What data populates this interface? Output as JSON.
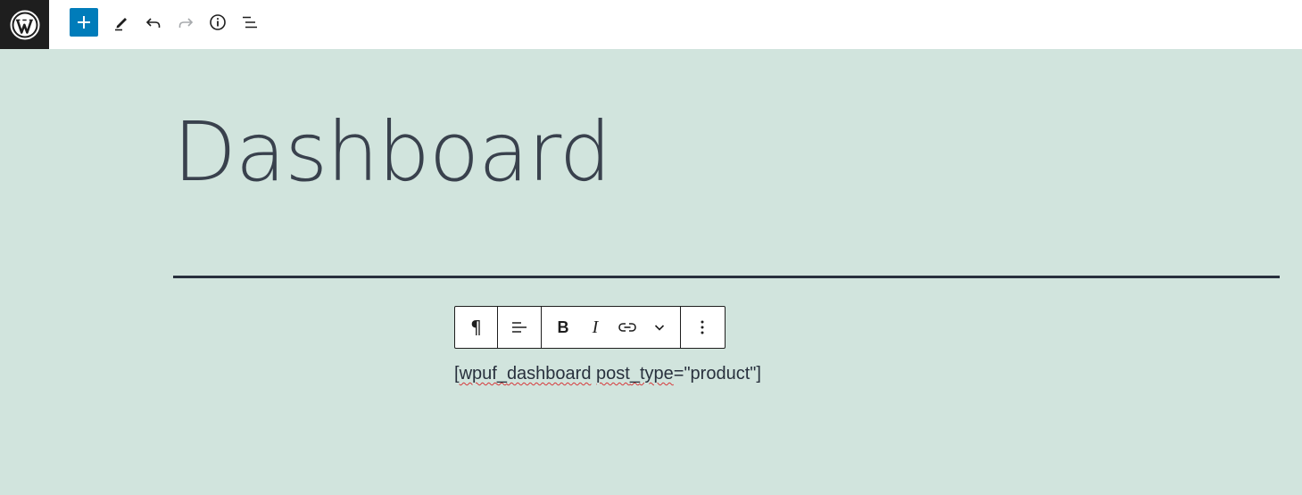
{
  "topbar": {
    "logo": "wordpress-logo",
    "add_block": {
      "icon": "plus-icon",
      "color": "#007cba"
    },
    "tools": [
      {
        "name": "edit",
        "icon": "pencil-icon"
      },
      {
        "name": "undo",
        "icon": "undo-icon"
      },
      {
        "name": "redo",
        "icon": "redo-icon",
        "disabled": true
      },
      {
        "name": "details",
        "icon": "info-icon"
      },
      {
        "name": "list-view",
        "icon": "list-view-icon"
      }
    ]
  },
  "editor": {
    "title": "Dashboard",
    "background_color": "#d1e4dd",
    "block_toolbar": {
      "paragraph_icon": "¶",
      "align_icon": "align-left-icon",
      "bold_label": "B",
      "italic_label": "I",
      "link_icon": "link-icon",
      "more_icon": "chevron-down-icon",
      "options_icon": "more-vertical-icon"
    },
    "paragraph": {
      "open": "[",
      "word1": "wpuf",
      "sep1": "_",
      "word2": "dashboard",
      "space": " ",
      "word3": "post",
      "sep2": "_",
      "word4": "type",
      "rest": "=\"product\"]"
    }
  }
}
